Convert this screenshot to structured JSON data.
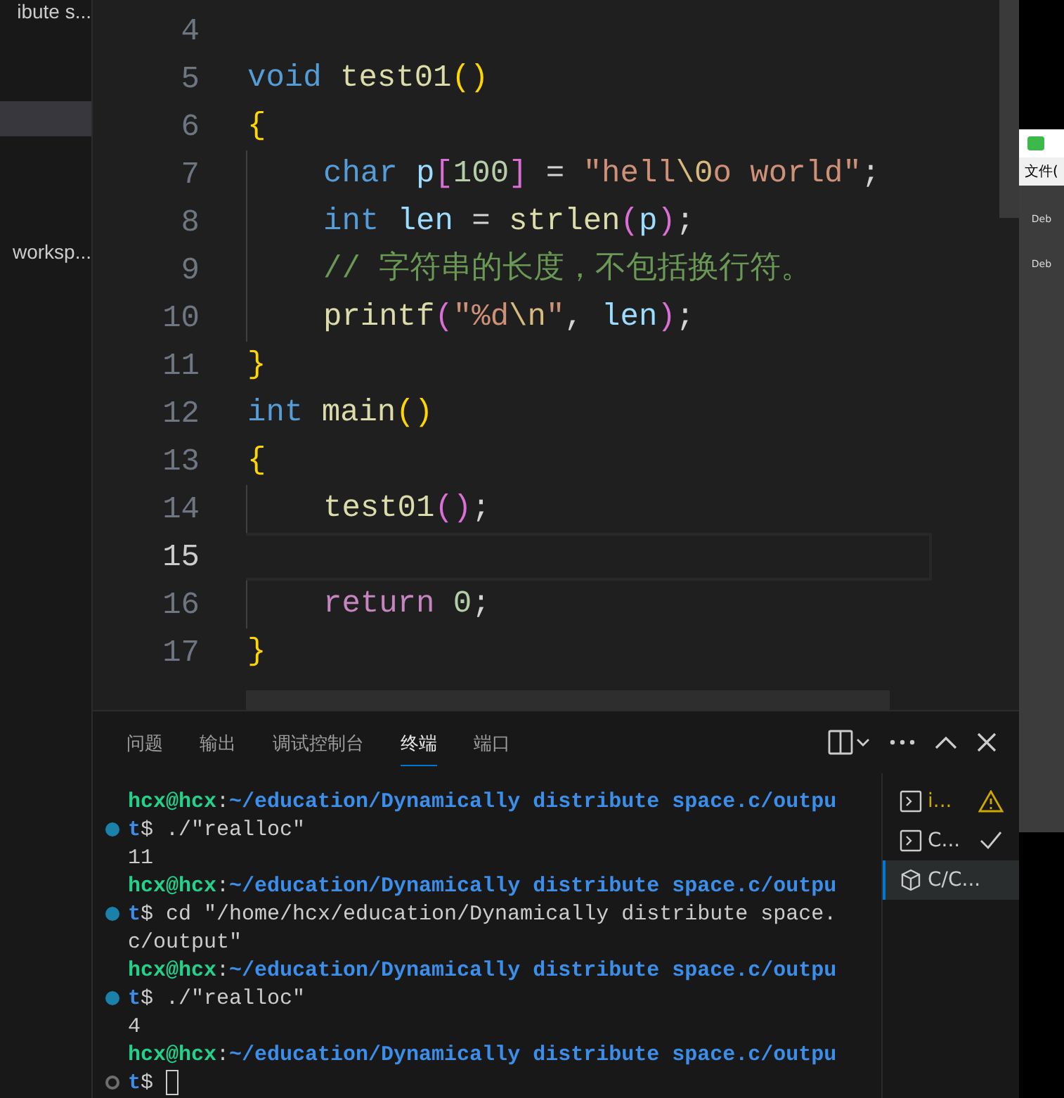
{
  "sidebar": {
    "items": [
      {
        "label": "ibute s...",
        "selected": false
      },
      {
        "selected": true
      },
      {
        "label": "worksp...",
        "selected": false
      }
    ]
  },
  "editor": {
    "lines": [
      {
        "number": "4",
        "current": false
      },
      {
        "number": "5",
        "current": false,
        "tokens": [
          {
            "kind": "keyword",
            "text": "void "
          },
          {
            "kind": "function",
            "text": "test01"
          },
          {
            "kind": "bracket1",
            "text": "()"
          }
        ]
      },
      {
        "number": "6",
        "current": false,
        "tokens": [
          {
            "kind": "bracket1",
            "text": "{"
          }
        ]
      },
      {
        "number": "7",
        "current": false,
        "indented": true,
        "tokens": [
          {
            "kind": "keyword",
            "text": "char "
          },
          {
            "kind": "variable",
            "text": "p"
          },
          {
            "kind": "bracket2",
            "text": "["
          },
          {
            "kind": "number",
            "text": "100"
          },
          {
            "kind": "bracket2",
            "text": "]"
          },
          {
            "kind": "plain",
            "text": " = "
          },
          {
            "kind": "string",
            "text": "\"hell"
          },
          {
            "kind": "escape",
            "text": "\\0"
          },
          {
            "kind": "string",
            "text": "o world\""
          },
          {
            "kind": "plain",
            "text": ";"
          }
        ]
      },
      {
        "number": "8",
        "current": false,
        "indented": true,
        "tokens": [
          {
            "kind": "keyword",
            "text": "int "
          },
          {
            "kind": "variable",
            "text": "len"
          },
          {
            "kind": "plain",
            "text": " = "
          },
          {
            "kind": "function",
            "text": "strlen"
          },
          {
            "kind": "bracket2",
            "text": "("
          },
          {
            "kind": "variable",
            "text": "p"
          },
          {
            "kind": "bracket2",
            "text": ")"
          },
          {
            "kind": "plain",
            "text": ";"
          }
        ]
      },
      {
        "number": "9",
        "current": false,
        "indented": true,
        "tokens": [
          {
            "kind": "comment",
            "text": "// 字符串的长度，不包括换行符。"
          }
        ]
      },
      {
        "number": "10",
        "current": false,
        "indented": true,
        "tokens": [
          {
            "kind": "function",
            "text": "printf"
          },
          {
            "kind": "bracket2",
            "text": "("
          },
          {
            "kind": "string",
            "text": "\"%d"
          },
          {
            "kind": "escape",
            "text": "\\n"
          },
          {
            "kind": "string",
            "text": "\""
          },
          {
            "kind": "plain",
            "text": ", "
          },
          {
            "kind": "variable",
            "text": "len"
          },
          {
            "kind": "bracket2",
            "text": ")"
          },
          {
            "kind": "plain",
            "text": ";"
          }
        ]
      },
      {
        "number": "11",
        "current": false,
        "tokens": [
          {
            "kind": "bracket1",
            "text": "}"
          }
        ]
      },
      {
        "number": "12",
        "current": false,
        "tokens": [
          {
            "kind": "keyword",
            "text": "int "
          },
          {
            "kind": "function",
            "text": "main"
          },
          {
            "kind": "bracket1",
            "text": "()"
          }
        ]
      },
      {
        "number": "13",
        "current": false,
        "tokens": [
          {
            "kind": "bracket1",
            "text": "{"
          }
        ]
      },
      {
        "number": "14",
        "current": false,
        "indented": true,
        "tokens": [
          {
            "kind": "function",
            "text": "test01"
          },
          {
            "kind": "bracket2",
            "text": "()"
          },
          {
            "kind": "plain",
            "text": ";"
          }
        ]
      },
      {
        "number": "15",
        "current": true
      },
      {
        "number": "16",
        "current": false,
        "indented": true,
        "tokens": [
          {
            "kind": "control",
            "text": "return "
          },
          {
            "kind": "number",
            "text": "0"
          },
          {
            "kind": "plain",
            "text": ";"
          }
        ]
      },
      {
        "number": "17",
        "current": false,
        "tokens": [
          {
            "kind": "bracket1",
            "text": "}"
          }
        ]
      }
    ]
  },
  "panel": {
    "tabs": [
      {
        "label": "问题",
        "selected": false
      },
      {
        "label": "输出",
        "selected": false
      },
      {
        "label": "调试控制台",
        "selected": false
      },
      {
        "label": "终端",
        "selected": true
      },
      {
        "label": "端口",
        "selected": false
      }
    ],
    "terminal_lines": [
      {
        "segments": [
          {
            "kind": "user",
            "text": "hcx@hcx"
          },
          {
            "kind": "plain",
            "text": ":"
          },
          {
            "kind": "path",
            "text": "~/education/Dynamically distribute space.c/outpu"
          }
        ]
      },
      {
        "command_done": true,
        "segments": [
          {
            "kind": "path",
            "text": "t"
          },
          {
            "kind": "plain",
            "text": "$ ./\"realloc\""
          }
        ]
      },
      {
        "segments": [
          {
            "kind": "plain",
            "text": "11"
          }
        ]
      },
      {
        "segments": [
          {
            "kind": "user",
            "text": "hcx@hcx"
          },
          {
            "kind": "plain",
            "text": ":"
          },
          {
            "kind": "path",
            "text": "~/education/Dynamically distribute space.c/outpu"
          }
        ]
      },
      {
        "command_done": true,
        "segments": [
          {
            "kind": "path",
            "text": "t"
          },
          {
            "kind": "plain",
            "text": "$ cd \"/home/hcx/education/Dynamically distribute space."
          }
        ]
      },
      {
        "segments": [
          {
            "kind": "plain",
            "text": "c/output\""
          }
        ]
      },
      {
        "segments": [
          {
            "kind": "user",
            "text": "hcx@hcx"
          },
          {
            "kind": "plain",
            "text": ":"
          },
          {
            "kind": "path",
            "text": "~/education/Dynamically distribute space.c/outpu"
          }
        ]
      },
      {
        "command_done": true,
        "segments": [
          {
            "kind": "path",
            "text": "t"
          },
          {
            "kind": "plain",
            "text": "$ ./\"realloc\""
          }
        ]
      },
      {
        "segments": [
          {
            "kind": "plain",
            "text": "4"
          }
        ]
      },
      {
        "segments": [
          {
            "kind": "user",
            "text": "hcx@hcx"
          },
          {
            "kind": "plain",
            "text": ":"
          },
          {
            "kind": "path",
            "text": "~/education/Dynamically distribute space.c/outpu"
          }
        ]
      },
      {
        "command_done": false,
        "cursor": true,
        "segments": [
          {
            "kind": "path",
            "text": "t"
          },
          {
            "kind": "plain",
            "text": "$"
          }
        ]
      }
    ],
    "terminals": [
      {
        "kind": "shell",
        "label": "i...",
        "warning": true,
        "succeeded": false,
        "selected": false
      },
      {
        "kind": "shell",
        "label": "C...",
        "warning": false,
        "succeeded": true,
        "selected": false
      },
      {
        "kind": "task",
        "label": "C/C...",
        "warning": false,
        "succeeded": false,
        "selected": true
      }
    ]
  },
  "background_app": {
    "menu": "文件(",
    "tools": [
      "Deb",
      "Deb"
    ]
  }
}
